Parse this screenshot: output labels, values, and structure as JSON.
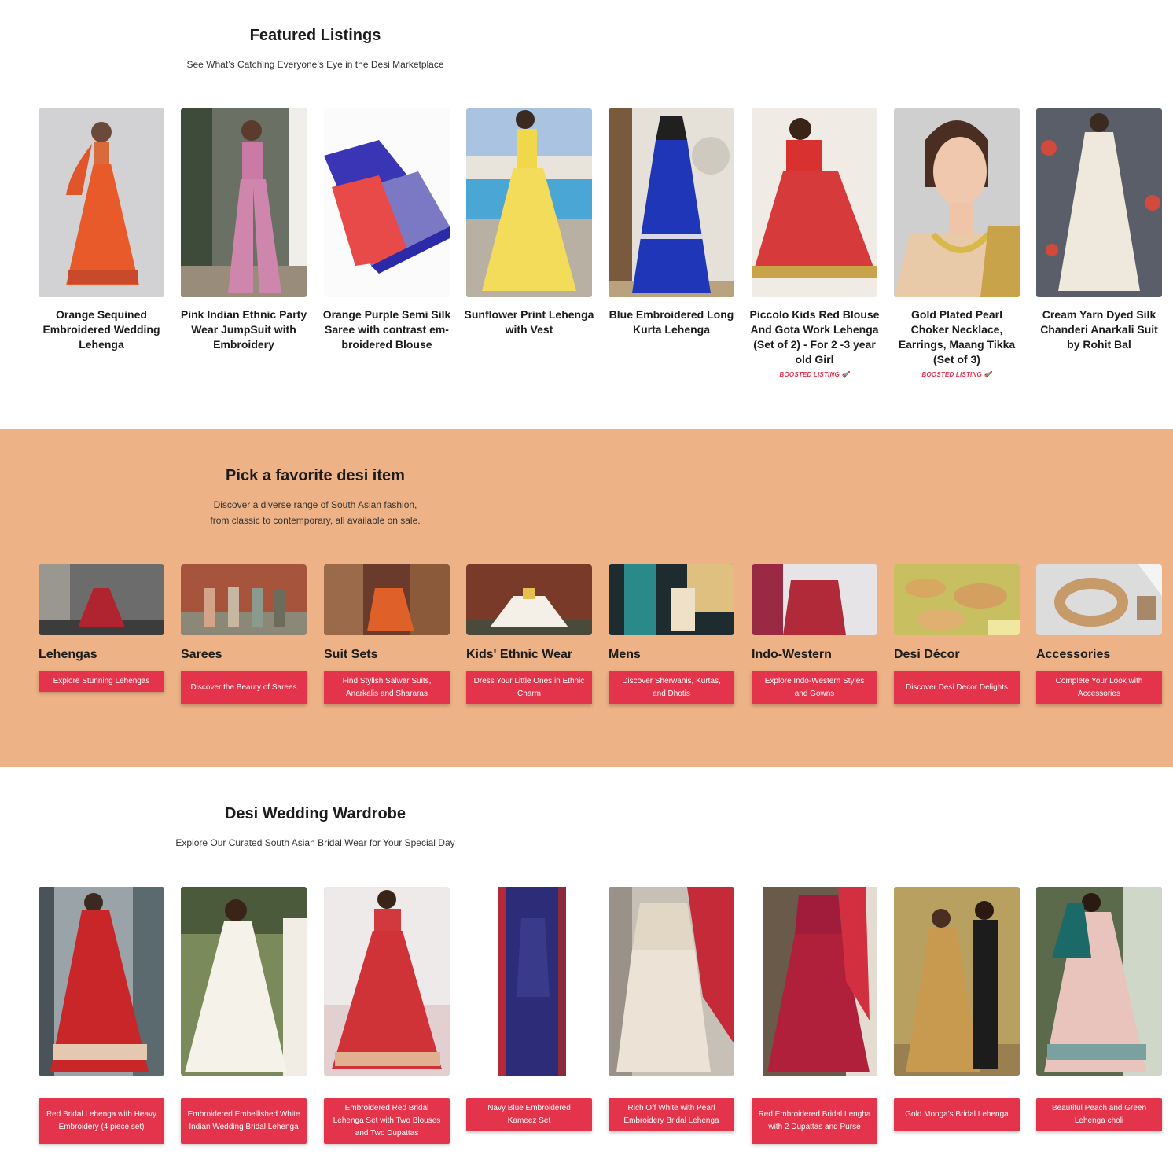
{
  "featured": {
    "title": "Featured Listings",
    "subtitle": "See What’s Catching Everyone’s Eye in the Desi Marketplace",
    "items": [
      {
        "title": "Orange Sequined Embroidered Wedding Lehenga",
        "badge": ""
      },
      {
        "title": "Pink Indian Ethnic Party Wear JumpSuit with Embroidery",
        "badge": ""
      },
      {
        "title": "Orange Purple Semi Silk Saree with contrast em-broidered Blouse",
        "badge": ""
      },
      {
        "title": "Sunflower Print Lehenga with Vest",
        "badge": ""
      },
      {
        "title": "Blue Embroidered Long Kurta Lehenga",
        "badge": ""
      },
      {
        "title": "Piccolo Kids Red Blouse And Gota Work Lehenga (Set of 2) - For 2 -3 year old Girl",
        "badge": "BOOSTED LISTING 🚀"
      },
      {
        "title": "Gold Plated Pearl Choker Necklace, Earrings, Maang Tikka (Set of 3)",
        "badge": "BOOSTED LISTING 🚀"
      },
      {
        "title": "Cream Yarn Dyed Silk Chanderi Anarkali Suit by Rohit Bal",
        "badge": ""
      }
    ]
  },
  "pick": {
    "title": "Pick a favorite desi item",
    "subtitle_line1": "Discover a diverse range of South Asian fashion,",
    "subtitle_line2": "from classic to contemporary, all available on sale.",
    "categories": [
      {
        "name": "Lehengas",
        "button": "Explore Stunning Lehengas"
      },
      {
        "name": "Sarees",
        "button": "Discover the Beauty of Sarees"
      },
      {
        "name": "Suit Sets",
        "button": "Find Stylish Salwar Suits, Anarkalis and Shararas"
      },
      {
        "name": "Kids' Ethnic Wear",
        "button": "Dress Your Little Ones in Ethnic Charm"
      },
      {
        "name": "Mens",
        "button": "Discover Sherwanis, Kurtas, and Dhotis"
      },
      {
        "name": "Indo-Western",
        "button": "Explore Indo-Western Styles and Gowns"
      },
      {
        "name": "Desi Décor",
        "button": "Discover Desi Decor Delights"
      },
      {
        "name": "Accessories",
        "button": "Complete Your Look with Accessories"
      }
    ]
  },
  "wedding": {
    "title": "Desi Wedding Wardrobe",
    "subtitle": "Explore Our Curated South Asian Bridal Wear for Your Special Day",
    "items": [
      {
        "button": "Red Bridal Lehenga with Heavy Embroidery (4 piece set)"
      },
      {
        "button": "Embroidered Embellished White Indian Wedding Bridal Lehenga"
      },
      {
        "button": "Embroidered Red Bridal Lehenga Set with Two Blouses and Two Dupattas"
      },
      {
        "button": "Navy Blue Embroidered Kameez Set"
      },
      {
        "button": "Rich Off White with Pearl Embroidery Bridal Lehenga"
      },
      {
        "button": "Red Embroidered Bridal Lengha with 2 Dupattas and Purse"
      },
      {
        "button": "Gold Monga's Bridal Lehenga"
      },
      {
        "button": "Beautiful Peach and Green Lehenga choli"
      }
    ]
  },
  "colors": {
    "accent_red": "#e3344b",
    "boost_red": "#e0314e",
    "pick_background": "#edb286"
  }
}
